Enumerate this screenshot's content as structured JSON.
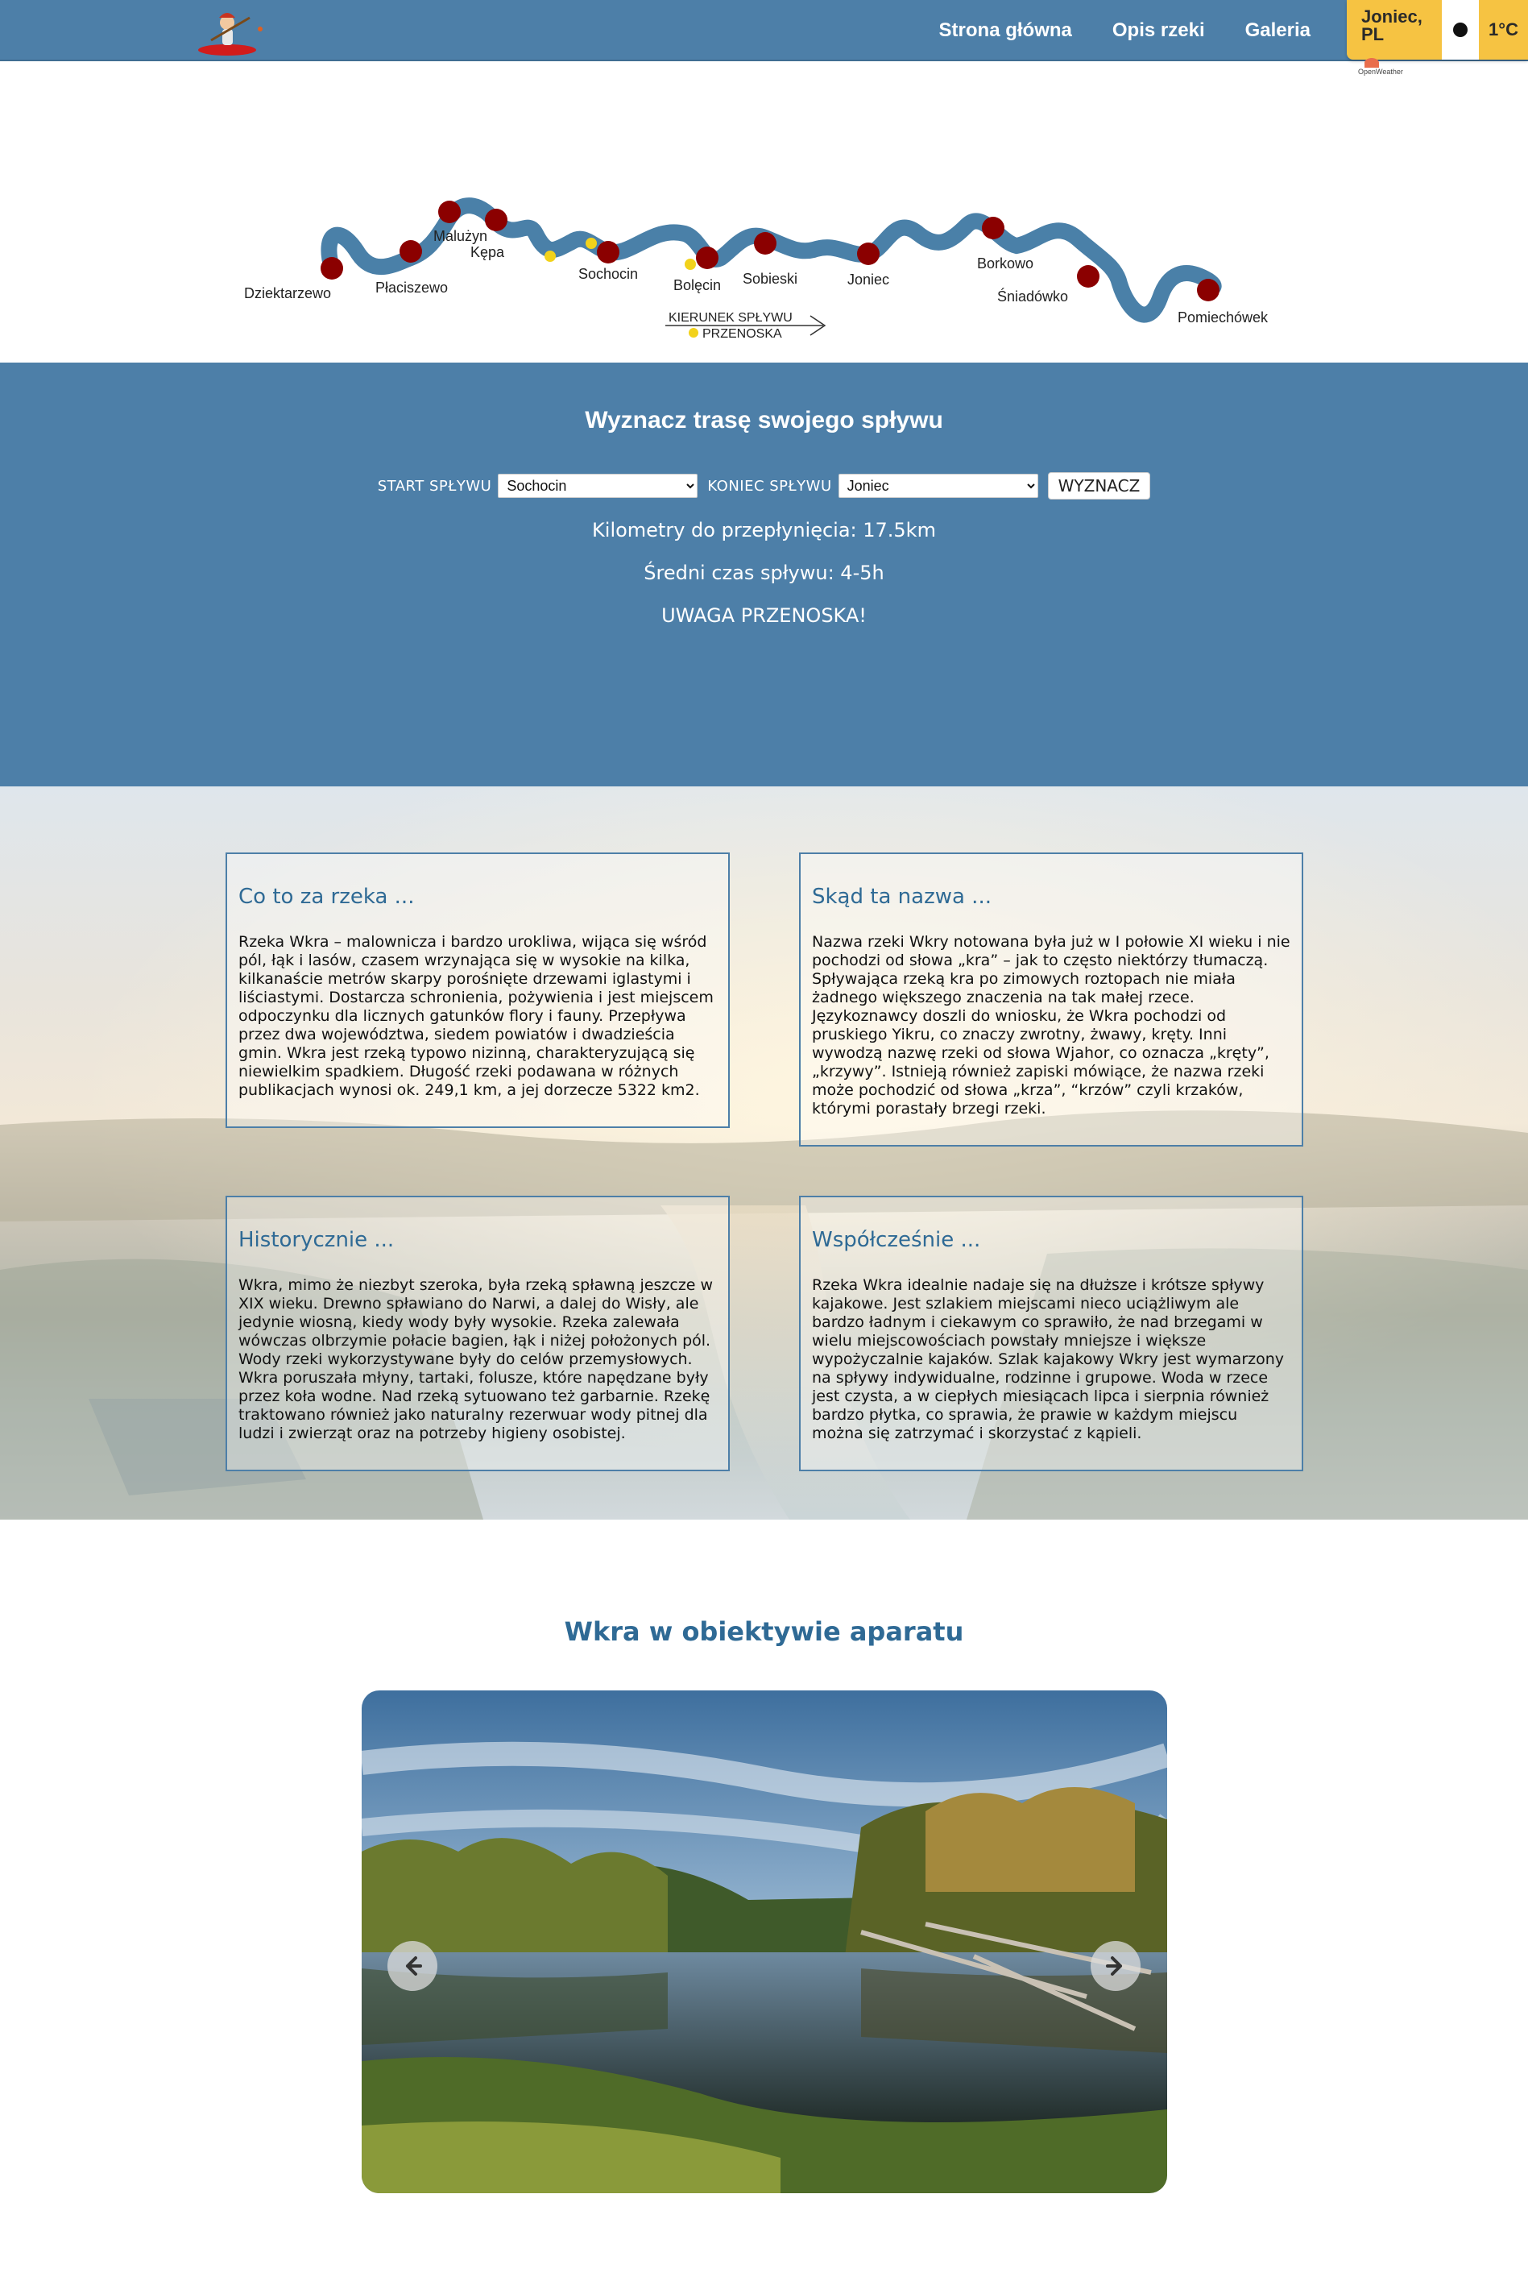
{
  "header": {
    "nav": [
      "Strona główna",
      "Opis rzeki",
      "Galeria"
    ],
    "weather": {
      "city_line1": "Joniec,",
      "city_line2": "PL",
      "temp": "1°C",
      "icon": "moon-icon"
    },
    "openweather_label": "OpenWeather"
  },
  "river_map": {
    "places": [
      "Dziektarzewo",
      "Płaciszewo",
      "Malużyn",
      "Kępa",
      "Sochocin",
      "Bolęcin",
      "Sobieski",
      "Joniec",
      "Borkowo",
      "Śniadówko",
      "Pomiechówek"
    ],
    "direction_label": "KIERUNEK SPŁYWU",
    "portage_label": "PRZENOSKA",
    "colors": {
      "river": "#4a80a8",
      "stop": "#8b0000",
      "portage": "#f2d21b"
    }
  },
  "route": {
    "title": "Wyznacz trasę swojego spływu",
    "start_label": "START SPŁYWU",
    "start_value": "Sochocin",
    "end_label": "KONIEC SPŁYWU",
    "end_value": "Joniec",
    "button": "WYZNACZ",
    "km_line": "Kilometry do przepłynięcia: 17.5km",
    "time_line": "Średni czas spływu: 4-5h",
    "warning": "UWAGA PRZENOSKA!"
  },
  "info": {
    "cards": [
      {
        "title": "Co to za rzeka ...",
        "text": "Rzeka Wkra – malownicza i bardzo urokliwa, wijąca się wśród pól, łąk i lasów, czasem wrzynająca się w wysokie na kilka, kilkanaście metrów skarpy porośnięte drzewami iglastymi i liściastymi. Dostarcza schronienia, pożywienia i jest miejscem odpoczynku dla licznych gatunków flory i fauny. Przepływa przez dwa województwa, siedem powiatów i dwadzieścia gmin. Wkra jest rzeką typowo nizinną, charakteryzującą się niewielkim spadkiem. Długość rzeki podawana w różnych publikacjach wynosi ok. 249,1 km, a jej dorzecze 5322 km2."
      },
      {
        "title": "Skąd ta nazwa ...",
        "text": "Nazwa rzeki Wkry notowana była już w I połowie XI wieku i nie pochodzi od słowa „kra” – jak to często niektórzy tłumaczą. Spływająca rzeką kra po zimowych roztopach nie miała żadnego większego znaczenia na tak małej rzece. Językoznawcy doszli do wniosku, że Wkra pochodzi od pruskiego Yikru, co znaczy zwrotny, żwawy, kręty. Inni wywodzą nazwę rzeki od słowa Wjahor, co oznacza „kręty”, „krzywy”. Istnieją również zapiski mówiące, że nazwa rzeki może pochodzić od słowa „krza”, “krzów” czyli krzaków, którymi porastały brzegi rzeki."
      },
      {
        "title": "Historycznie ...",
        "text": "Wkra, mimo że niezbyt szeroka, była rzeką spławną jeszcze w XIX wieku. Drewno spławiano do Narwi, a dalej do Wisły, ale jedynie wiosną, kiedy wody były wysokie. Rzeka zalewała wówczas olbrzymie połacie bagien, łąk i niżej położonych pól. Wody rzeki wykorzystywane były do celów przemysłowych. Wkra poruszała młyny, tartaki, folusze, które napędzane były przez koła wodne. Nad rzeką sytuowano też garbarnie. Rzekę traktowano również jako naturalny rezerwuar wody pitnej dla ludzi i zwierząt oraz na potrzeby higieny osobistej."
      },
      {
        "title": "Współcześnie ...",
        "text": "Rzeka Wkra idealnie nadaje się na dłuższe i krótsze spływy kajakowe. Jest szlakiem miejscami nieco uciążliwym ale bardzo ładnym i ciekawym co sprawiło, że nad brzegami w wielu miejscowościach powstały mniejsze i większe wypożyczalnie kajaków. Szlak kajakowy Wkry jest wymarzony na spływy indywidualne, rodzinne i grupowe. Woda w rzece jest czysta, a w ciepłych miesiącach lipca i sierpnia również bardzo płytka, co sprawia, że prawie w każdym miejscu można się zatrzymać i skorzystać z kąpieli."
      }
    ]
  },
  "gallery": {
    "title": "Wkra w obiektywie aparatu",
    "prev_icon": "arrow-left-icon",
    "next_icon": "arrow-right-icon"
  }
}
